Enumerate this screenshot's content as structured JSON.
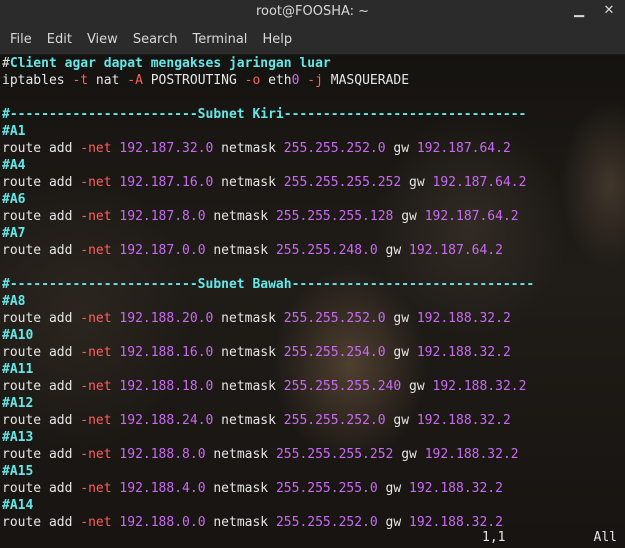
{
  "window": {
    "title": "root@FOOSHA: ~"
  },
  "menu": [
    "File",
    "Edit",
    "View",
    "Search",
    "Terminal",
    "Help"
  ],
  "lines": [
    [
      {
        "t": "#",
        "c": "cursor"
      },
      {
        "t": "Client agar dapat mengakses jaringan luar",
        "c": "comment"
      }
    ],
    [
      {
        "t": "iptables ",
        "c": "text"
      },
      {
        "t": "-t",
        "c": "flag"
      },
      {
        "t": " nat ",
        "c": "text"
      },
      {
        "t": "-A",
        "c": "flag"
      },
      {
        "t": " POSTROUTING ",
        "c": "text"
      },
      {
        "t": "-o",
        "c": "flag"
      },
      {
        "t": " eth",
        "c": "text"
      },
      {
        "t": "0",
        "c": "ip"
      },
      {
        "t": " ",
        "c": "text"
      },
      {
        "t": "-j",
        "c": "flag"
      },
      {
        "t": " MASQUERADE",
        "c": "text"
      }
    ],
    [],
    [
      {
        "t": "#------------------------Subnet Kiri-------------------------------",
        "c": "comment"
      }
    ],
    [
      {
        "t": "#A1",
        "c": "comment"
      }
    ],
    [
      {
        "t": "route add ",
        "c": "text"
      },
      {
        "t": "-net",
        "c": "flag"
      },
      {
        "t": " ",
        "c": "text"
      },
      {
        "t": "192.187.32.0",
        "c": "ip"
      },
      {
        "t": " netmask ",
        "c": "text"
      },
      {
        "t": "255.255.252.0",
        "c": "ip"
      },
      {
        "t": " gw ",
        "c": "text"
      },
      {
        "t": "192.187.64.2",
        "c": "ip"
      }
    ],
    [
      {
        "t": "#A4",
        "c": "comment"
      }
    ],
    [
      {
        "t": "route add ",
        "c": "text"
      },
      {
        "t": "-net",
        "c": "flag"
      },
      {
        "t": " ",
        "c": "text"
      },
      {
        "t": "192.187.16.0",
        "c": "ip"
      },
      {
        "t": " netmask ",
        "c": "text"
      },
      {
        "t": "255.255.255.252",
        "c": "ip"
      },
      {
        "t": " gw ",
        "c": "text"
      },
      {
        "t": "192.187.64.2",
        "c": "ip"
      }
    ],
    [
      {
        "t": "#A6",
        "c": "comment"
      }
    ],
    [
      {
        "t": "route add ",
        "c": "text"
      },
      {
        "t": "-net",
        "c": "flag"
      },
      {
        "t": " ",
        "c": "text"
      },
      {
        "t": "192.187.8.0",
        "c": "ip"
      },
      {
        "t": " netmask ",
        "c": "text"
      },
      {
        "t": "255.255.255.128",
        "c": "ip"
      },
      {
        "t": " gw ",
        "c": "text"
      },
      {
        "t": "192.187.64.2",
        "c": "ip"
      }
    ],
    [
      {
        "t": "#A7",
        "c": "comment"
      }
    ],
    [
      {
        "t": "route add ",
        "c": "text"
      },
      {
        "t": "-net",
        "c": "flag"
      },
      {
        "t": " ",
        "c": "text"
      },
      {
        "t": "192.187.0.0",
        "c": "ip"
      },
      {
        "t": " netmask ",
        "c": "text"
      },
      {
        "t": "255.255.248.0",
        "c": "ip"
      },
      {
        "t": " gw ",
        "c": "text"
      },
      {
        "t": "192.187.64.2",
        "c": "ip"
      }
    ],
    [],
    [
      {
        "t": "#------------------------Subnet Bawah-------------------------------",
        "c": "comment"
      }
    ],
    [
      {
        "t": "#A8",
        "c": "comment"
      }
    ],
    [
      {
        "t": "route add ",
        "c": "text"
      },
      {
        "t": "-net",
        "c": "flag"
      },
      {
        "t": " ",
        "c": "text"
      },
      {
        "t": "192.188.20.0",
        "c": "ip"
      },
      {
        "t": " netmask ",
        "c": "text"
      },
      {
        "t": "255.255.252.0",
        "c": "ip"
      },
      {
        "t": " gw ",
        "c": "text"
      },
      {
        "t": "192.188.32.2",
        "c": "ip"
      }
    ],
    [
      {
        "t": "#A10",
        "c": "comment"
      }
    ],
    [
      {
        "t": "route add ",
        "c": "text"
      },
      {
        "t": "-net",
        "c": "flag"
      },
      {
        "t": " ",
        "c": "text"
      },
      {
        "t": "192.188.16.0",
        "c": "ip"
      },
      {
        "t": " netmask ",
        "c": "text"
      },
      {
        "t": "255.255.254.0",
        "c": "ip"
      },
      {
        "t": " gw ",
        "c": "text"
      },
      {
        "t": "192.188.32.2",
        "c": "ip"
      }
    ],
    [
      {
        "t": "#A11",
        "c": "comment"
      }
    ],
    [
      {
        "t": "route add ",
        "c": "text"
      },
      {
        "t": "-net",
        "c": "flag"
      },
      {
        "t": " ",
        "c": "text"
      },
      {
        "t": "192.188.18.0",
        "c": "ip"
      },
      {
        "t": " netmask ",
        "c": "text"
      },
      {
        "t": "255.255.255.240",
        "c": "ip"
      },
      {
        "t": " gw ",
        "c": "text"
      },
      {
        "t": "192.188.32.2",
        "c": "ip"
      }
    ],
    [
      {
        "t": "#A12",
        "c": "comment"
      }
    ],
    [
      {
        "t": "route add ",
        "c": "text"
      },
      {
        "t": "-net",
        "c": "flag"
      },
      {
        "t": " ",
        "c": "text"
      },
      {
        "t": "192.188.24.0",
        "c": "ip"
      },
      {
        "t": " netmask ",
        "c": "text"
      },
      {
        "t": "255.255.252.0",
        "c": "ip"
      },
      {
        "t": " gw ",
        "c": "text"
      },
      {
        "t": "192.188.32.2",
        "c": "ip"
      }
    ],
    [
      {
        "t": "#A13",
        "c": "comment"
      }
    ],
    [
      {
        "t": "route add ",
        "c": "text"
      },
      {
        "t": "-net",
        "c": "flag"
      },
      {
        "t": " ",
        "c": "text"
      },
      {
        "t": "192.188.8.0",
        "c": "ip"
      },
      {
        "t": " netmask ",
        "c": "text"
      },
      {
        "t": "255.255.255.252",
        "c": "ip"
      },
      {
        "t": " gw ",
        "c": "text"
      },
      {
        "t": "192.188.32.2",
        "c": "ip"
      }
    ],
    [
      {
        "t": "#A15",
        "c": "comment"
      }
    ],
    [
      {
        "t": "route add ",
        "c": "text"
      },
      {
        "t": "-net",
        "c": "flag"
      },
      {
        "t": " ",
        "c": "text"
      },
      {
        "t": "192.188.4.0",
        "c": "ip"
      },
      {
        "t": " netmask ",
        "c": "text"
      },
      {
        "t": "255.255.255.0",
        "c": "ip"
      },
      {
        "t": " gw ",
        "c": "text"
      },
      {
        "t": "192.188.32.2",
        "c": "ip"
      }
    ],
    [
      {
        "t": "#A14",
        "c": "comment"
      }
    ],
    [
      {
        "t": "route add ",
        "c": "text"
      },
      {
        "t": "-net",
        "c": "flag"
      },
      {
        "t": " ",
        "c": "text"
      },
      {
        "t": "192.188.0.0",
        "c": "ip"
      },
      {
        "t": " netmask ",
        "c": "text"
      },
      {
        "t": "255.255.252.0",
        "c": "ip"
      },
      {
        "t": " gw ",
        "c": "text"
      },
      {
        "t": "192.188.32.2",
        "c": "ip"
      }
    ]
  ],
  "status": {
    "position": "1,1",
    "scroll": "All"
  },
  "colors": {
    "comment": "#63e7e7",
    "flag": "#ff5f5f",
    "ip": "#c96bf2",
    "text": "#e6e6e6"
  }
}
